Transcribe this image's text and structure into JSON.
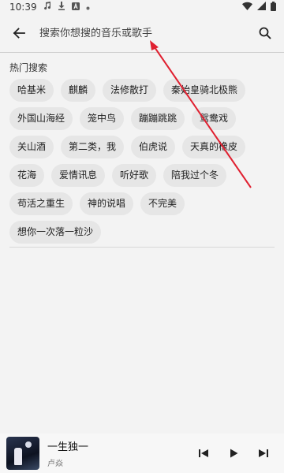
{
  "status_bar": {
    "time": "10:39",
    "icons": [
      "music-note-icon",
      "download-icon",
      "a-badge-icon",
      "dot-icon",
      "wifi-icon",
      "signal-icon",
      "battery-icon"
    ]
  },
  "search": {
    "placeholder": "搜索你想搜的音乐或歌手"
  },
  "hot_search": {
    "title": "热门搜索",
    "tags": [
      "哈基米",
      "麒麟",
      "法修散打",
      "秦始皇骑北极熊",
      "外国山海经",
      "笼中鸟",
      "蹦蹦跳跳",
      "鸳鸯戏",
      "关山酒",
      "第二类，我",
      "伯虎说",
      "天真的橡皮",
      "花海",
      "爱情讯息",
      "听好歌",
      "陪我过个冬",
      "苟活之重生",
      "神的说唱",
      "不完美",
      "想你一次落一粒沙"
    ]
  },
  "player": {
    "title": "一生独一",
    "artist": "卢焱"
  },
  "colors": {
    "background": "#f3f3f3",
    "tag_background": "#e6e6e6",
    "annotation_arrow": "#e02030"
  }
}
